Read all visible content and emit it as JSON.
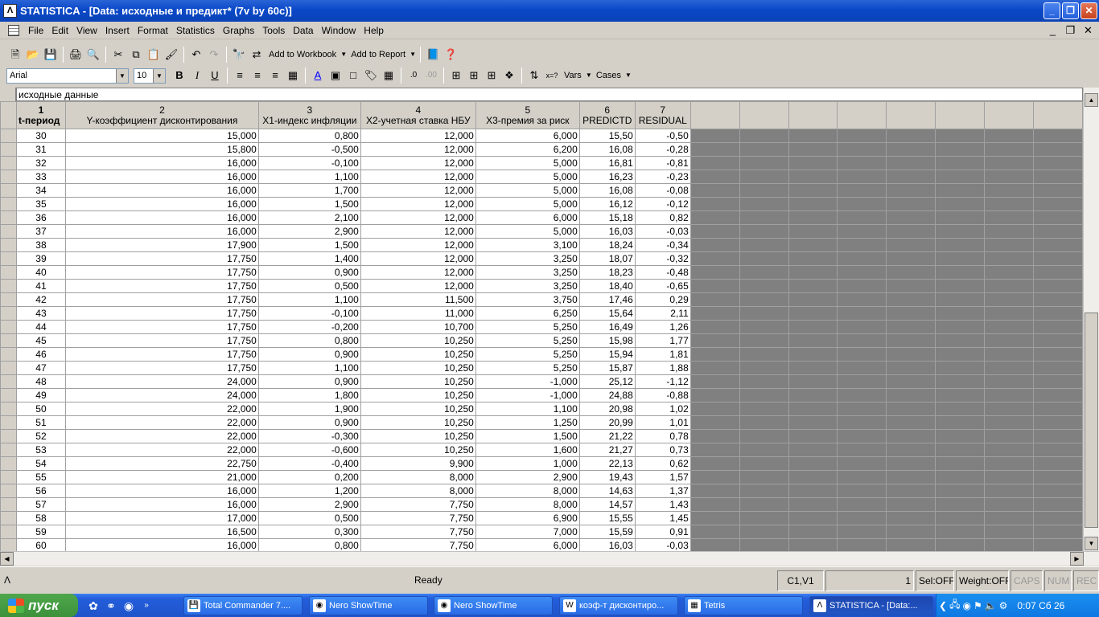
{
  "window": {
    "title": "STATISTICA - [Data: исходные и предикт* (7v by 60c)]",
    "app_icon": "statistica-icon"
  },
  "menu": [
    "File",
    "Edit",
    "View",
    "Insert",
    "Format",
    "Statistics",
    "Graphs",
    "Tools",
    "Data",
    "Window",
    "Help"
  ],
  "toolbar": {
    "add_to_workbook": "Add to Workbook",
    "add_to_report": "Add to Report",
    "font_name": "Arial",
    "font_size": "10",
    "bold": "B",
    "italic": "I",
    "underline": "U",
    "vars": "Vars",
    "cases": "Cases"
  },
  "sheet": {
    "title": "исходные данные",
    "columns": [
      {
        "num": "1",
        "name": "t-период"
      },
      {
        "num": "2",
        "name": "Y-коэффициент дисконтирования"
      },
      {
        "num": "3",
        "name": "X1-индекс инфляции"
      },
      {
        "num": "4",
        "name": "X2-учетная ставка НБУ"
      },
      {
        "num": "5",
        "name": "X3-премия за риск"
      },
      {
        "num": "6",
        "name": "PREDICTD"
      },
      {
        "num": "7",
        "name": "RESIDUAL"
      }
    ],
    "rows": [
      [
        "30",
        "15,000",
        "0,800",
        "12,000",
        "6,000",
        "15,50",
        "-0,50"
      ],
      [
        "31",
        "15,800",
        "-0,500",
        "12,000",
        "6,200",
        "16,08",
        "-0,28"
      ],
      [
        "32",
        "16,000",
        "-0,100",
        "12,000",
        "5,000",
        "16,81",
        "-0,81"
      ],
      [
        "33",
        "16,000",
        "1,100",
        "12,000",
        "5,000",
        "16,23",
        "-0,23"
      ],
      [
        "34",
        "16,000",
        "1,700",
        "12,000",
        "5,000",
        "16,08",
        "-0,08"
      ],
      [
        "35",
        "16,000",
        "1,500",
        "12,000",
        "5,000",
        "16,12",
        "-0,12"
      ],
      [
        "36",
        "16,000",
        "2,100",
        "12,000",
        "6,000",
        "15,18",
        "0,82"
      ],
      [
        "37",
        "16,000",
        "2,900",
        "12,000",
        "5,000",
        "16,03",
        "-0,03"
      ],
      [
        "38",
        "17,900",
        "1,500",
        "12,000",
        "3,100",
        "18,24",
        "-0,34"
      ],
      [
        "39",
        "17,750",
        "1,400",
        "12,000",
        "3,250",
        "18,07",
        "-0,32"
      ],
      [
        "40",
        "17,750",
        "0,900",
        "12,000",
        "3,250",
        "18,23",
        "-0,48"
      ],
      [
        "41",
        "17,750",
        "0,500",
        "12,000",
        "3,250",
        "18,40",
        "-0,65"
      ],
      [
        "42",
        "17,750",
        "1,100",
        "11,500",
        "3,750",
        "17,46",
        "0,29"
      ],
      [
        "43",
        "17,750",
        "-0,100",
        "11,000",
        "6,250",
        "15,64",
        "2,11"
      ],
      [
        "44",
        "17,750",
        "-0,200",
        "10,700",
        "5,250",
        "16,49",
        "1,26"
      ],
      [
        "45",
        "17,750",
        "0,800",
        "10,250",
        "5,250",
        "15,98",
        "1,77"
      ],
      [
        "46",
        "17,750",
        "0,900",
        "10,250",
        "5,250",
        "15,94",
        "1,81"
      ],
      [
        "47",
        "17,750",
        "1,100",
        "10,250",
        "5,250",
        "15,87",
        "1,88"
      ],
      [
        "48",
        "24,000",
        "0,900",
        "10,250",
        "-1,000",
        "25,12",
        "-1,12"
      ],
      [
        "49",
        "24,000",
        "1,800",
        "10,250",
        "-1,000",
        "24,88",
        "-0,88"
      ],
      [
        "50",
        "22,000",
        "1,900",
        "10,250",
        "1,100",
        "20,98",
        "1,02"
      ],
      [
        "51",
        "22,000",
        "0,900",
        "10,250",
        "1,250",
        "20,99",
        "1,01"
      ],
      [
        "52",
        "22,000",
        "-0,300",
        "10,250",
        "1,500",
        "21,22",
        "0,78"
      ],
      [
        "53",
        "22,000",
        "-0,600",
        "10,250",
        "1,600",
        "21,27",
        "0,73"
      ],
      [
        "54",
        "22,750",
        "-0,400",
        "9,900",
        "1,000",
        "22,13",
        "0,62"
      ],
      [
        "55",
        "21,000",
        "0,200",
        "8,000",
        "2,900",
        "19,43",
        "1,57"
      ],
      [
        "56",
        "16,000",
        "1,200",
        "8,000",
        "8,000",
        "14,63",
        "1,37"
      ],
      [
        "57",
        "16,000",
        "2,900",
        "7,750",
        "8,000",
        "14,57",
        "1,43"
      ],
      [
        "58",
        "17,000",
        "0,500",
        "7,750",
        "6,900",
        "15,55",
        "1,45"
      ],
      [
        "59",
        "16,500",
        "0,300",
        "7,750",
        "7,000",
        "15,59",
        "0,91"
      ],
      [
        "60",
        "16,000",
        "0,800",
        "7,750",
        "6,000",
        "16,03",
        "-0,03"
      ]
    ]
  },
  "status": {
    "ready": "Ready",
    "cell": "C1,V1",
    "value": "1",
    "sel": "Sel:OFF",
    "weight": "Weight:OFF",
    "caps": "CAPS",
    "num": "NUM",
    "rec": "REC"
  },
  "taskbar": {
    "start": "пуск",
    "tasks": [
      {
        "label": "Total Commander 7....",
        "active": false
      },
      {
        "label": "Nero ShowTime",
        "active": false
      },
      {
        "label": "Nero ShowTime",
        "active": false
      },
      {
        "label": "коэф-т дисконтиро...",
        "active": false
      },
      {
        "label": "Tetris",
        "active": false
      },
      {
        "label": "STATISTICA - [Data:...",
        "active": true
      }
    ],
    "clock": "0:07 Сб 26"
  },
  "colors": {
    "title_blue": "#0a48c8",
    "chrome": "#d4d0c8",
    "grid_empty": "#808080",
    "start_green": "#3c913a"
  }
}
